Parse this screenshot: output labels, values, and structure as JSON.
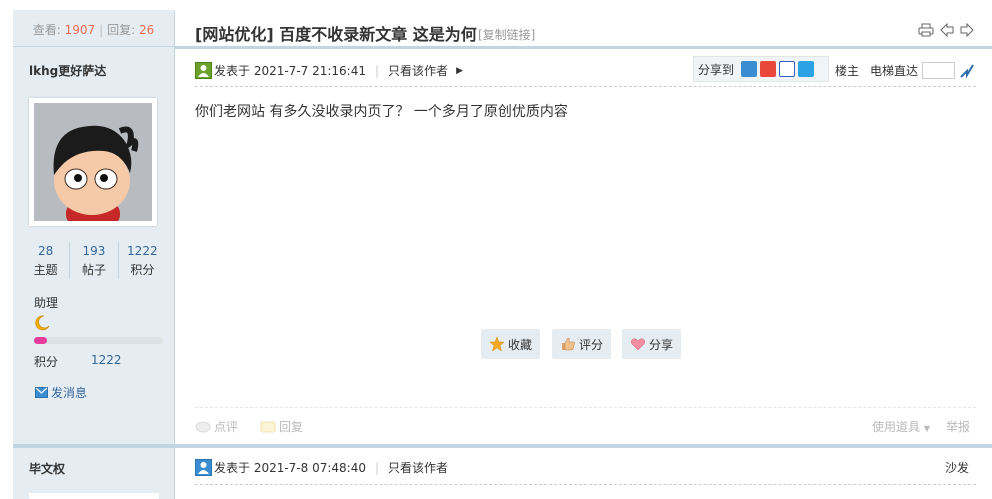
{
  "thread": {
    "views_label": "查看:",
    "views": "1907",
    "replies_label": "回复:",
    "replies": "26",
    "title": "[网站优化] 百度不收录新文章 这是为何",
    "copy_link": "[复制链接]"
  },
  "post1": {
    "author": "lkhg更好萨达",
    "stats": [
      {
        "value": "28",
        "label": "主题"
      },
      {
        "value": "193",
        "label": "帖子"
      },
      {
        "value": "1222",
        "label": "积分"
      }
    ],
    "rank": "助理",
    "progress_percent": 10,
    "credit_label": "积分",
    "credit_value": "1222",
    "pm_label": "发消息",
    "posted": "发表于  2021-7-7 21:16:41",
    "author_only": "只看该作者",
    "share_label": "分享到",
    "floor": "楼主",
    "jump_label": "电梯直达",
    "content": "你们老网站 有多久没收录内页了？  一个多月了原创优质内容",
    "buttons": {
      "fav": "收藏",
      "rate": "评分",
      "share": "分享"
    },
    "footer": {
      "comment": "点评",
      "reply": "回复",
      "tools": "使用道具",
      "report": "举报"
    }
  },
  "post2": {
    "author": "毕文权",
    "posted": "发表于  2021-7-8 07:48:40",
    "author_only": "只看该作者",
    "floor": "沙发"
  },
  "colors": {
    "accent": "#369",
    "highlight": "#f26c4f",
    "border": "#c2d5e3",
    "sidebar": "#e5edf2"
  }
}
